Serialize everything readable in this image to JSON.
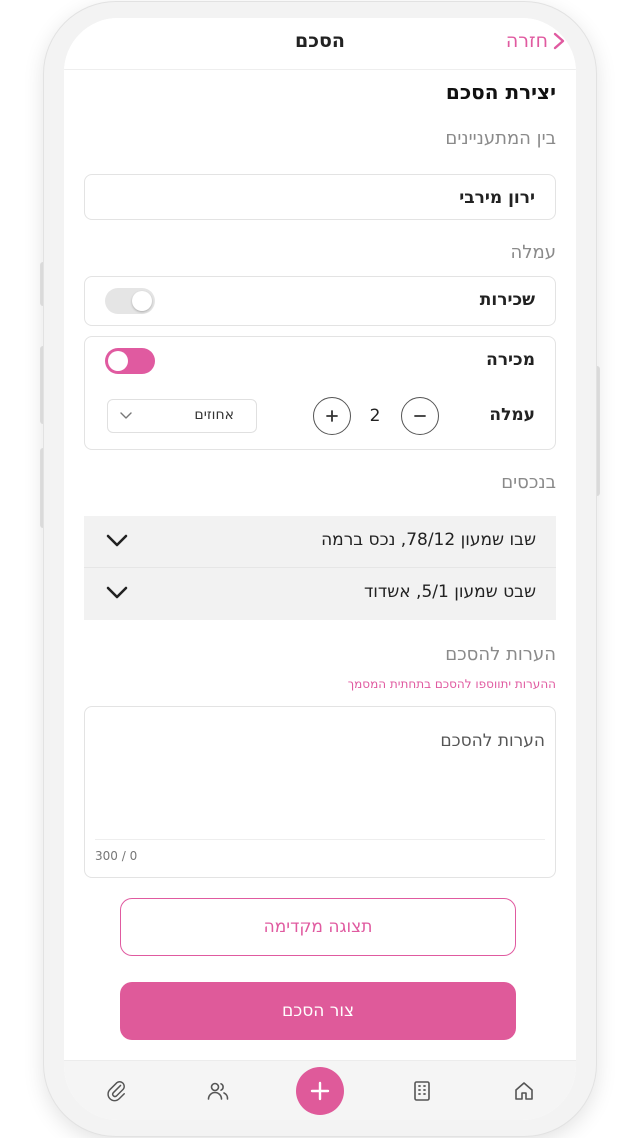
{
  "header": {
    "title": "הסכם",
    "back_label": "חזרה"
  },
  "page": {
    "title": "יצירת הסכם"
  },
  "parties": {
    "label": "בין המתעניינים",
    "name": "ירון מירבי"
  },
  "commission": {
    "label": "עמלה",
    "rental": {
      "label": "שכירות",
      "enabled": false
    },
    "sale": {
      "label": "מכירה",
      "enabled": true
    },
    "amount": {
      "label": "עמלה",
      "value": "2"
    },
    "unit_select": {
      "value": "אחוזים"
    }
  },
  "properties": {
    "label": "בנכסים",
    "items": [
      {
        "label": "שבו שמעון 78/12, נכס ברמה"
      },
      {
        "label": "שבט שמעון 5/1, אשדוד"
      }
    ]
  },
  "notes": {
    "label": "הערות להסכם",
    "hint": "ההערות יתווספו להסכם בתחתית המסמך",
    "placeholder": "הערות להסכם",
    "counter": "300 / 0"
  },
  "actions": {
    "preview_label": "תצוגה מקדימה",
    "create_label": "צור הסכם"
  },
  "bottom_nav": {
    "items": [
      "home-icon",
      "building-icon",
      "add-icon",
      "users-icon",
      "paperclip-icon"
    ]
  },
  "colors": {
    "accent": "#e05aa0",
    "toggle_off": "#e5e5e5",
    "row_bg": "#f2f2f2"
  }
}
